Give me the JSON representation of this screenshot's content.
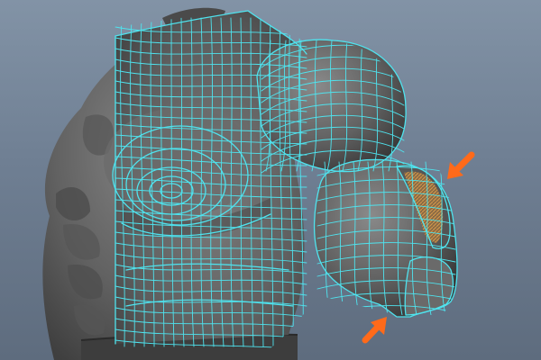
{
  "viewport": {
    "background_top": "#8293a6",
    "background_bottom": "#5e6c7e"
  },
  "model": {
    "description_icon": "torso-mesh-icon",
    "base_color": "#5f5f5f",
    "wireframe_color": "#4fe3ee",
    "selected_face_color": "#c9893f"
  },
  "annotations": [
    {
      "icon": "arrow-icon",
      "color": "#ff6a1a"
    },
    {
      "icon": "arrow-icon",
      "color": "#ff6a1a"
    }
  ]
}
